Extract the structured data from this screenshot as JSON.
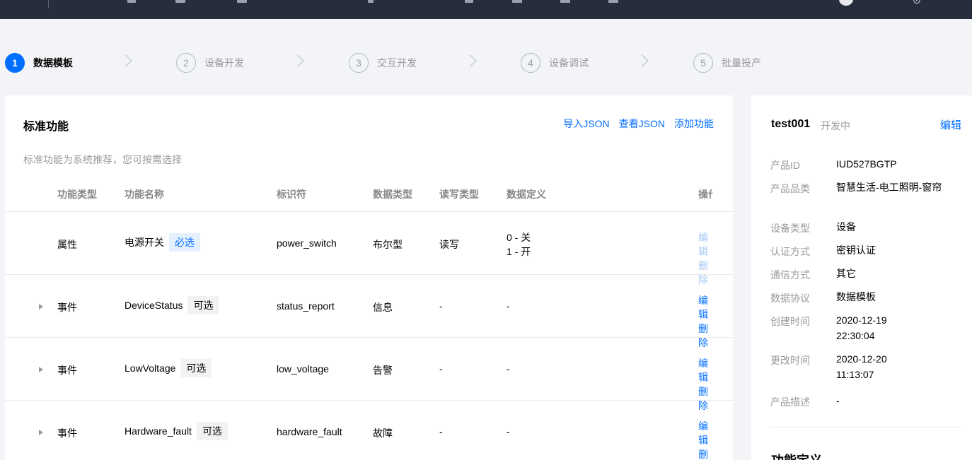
{
  "steps": [
    {
      "num": "1",
      "label": "数据模板",
      "active": true
    },
    {
      "num": "2",
      "label": "设备开发"
    },
    {
      "num": "3",
      "label": "交互开发"
    },
    {
      "num": "4",
      "label": "设备调试"
    },
    {
      "num": "5",
      "label": "批量投产"
    }
  ],
  "main": {
    "title": "标准功能",
    "actions": [
      "导入JSON",
      "查看JSON",
      "添加功能"
    ],
    "description": "标准功能为系统推荐，您可按需选择",
    "columns": [
      "功能类型",
      "功能名称",
      "标识符",
      "数据类型",
      "读写类型",
      "数据定义",
      "操作"
    ],
    "rows": [
      {
        "type": "属性",
        "name": "电源开关",
        "tag": "必选",
        "id": "power_switch",
        "dtype": "布尔型",
        "rw": "读写",
        "def1": "0 - 关",
        "def2": "1 - 开",
        "op_edit": "编辑",
        "op_delete": "删除"
      },
      {
        "type": "事件",
        "name": "DeviceStatus",
        "tag": "可选",
        "id": "status_report",
        "dtype": "信息",
        "rw": "-",
        "def1": "-",
        "op_edit": "编辑",
        "op_delete": "删除"
      },
      {
        "type": "事件",
        "name": "LowVoltage",
        "tag": "可选",
        "id": "low_voltage",
        "dtype": "告警",
        "rw": "-",
        "def1": "-",
        "op_edit": "编辑",
        "op_delete": "删除"
      },
      {
        "type": "事件",
        "name": "Hardware_fault",
        "tag": "可选",
        "id": "hardware_fault",
        "dtype": "故障",
        "rw": "-",
        "def1": "-",
        "op_edit": "编辑",
        "op_delete": "删除"
      }
    ]
  },
  "side": {
    "product_name": "test001",
    "status": "开发中",
    "edit": "编辑",
    "fields": [
      {
        "k": "产品ID",
        "v": "IUD527BGTP"
      },
      {
        "k": "产品品类",
        "v": "智慧生活-电工照明-窗帘"
      },
      {
        "k": "设备类型",
        "v": "设备"
      },
      {
        "k": "认证方式",
        "v": "密钥认证"
      },
      {
        "k": "通信方式",
        "v": "其它"
      },
      {
        "k": "数据协议",
        "v": "数据模板"
      },
      {
        "k": "创建时间",
        "v": "2020-12-19 22:30:04"
      },
      {
        "k": "更改时间",
        "v": "2020-12-20 11:13:07"
      },
      {
        "k": "产品描述",
        "v": "-"
      }
    ],
    "section_title": "功能定义"
  },
  "colors": {
    "accent": "#006eff",
    "topbar": "#262d3d",
    "muted": "#999999"
  }
}
